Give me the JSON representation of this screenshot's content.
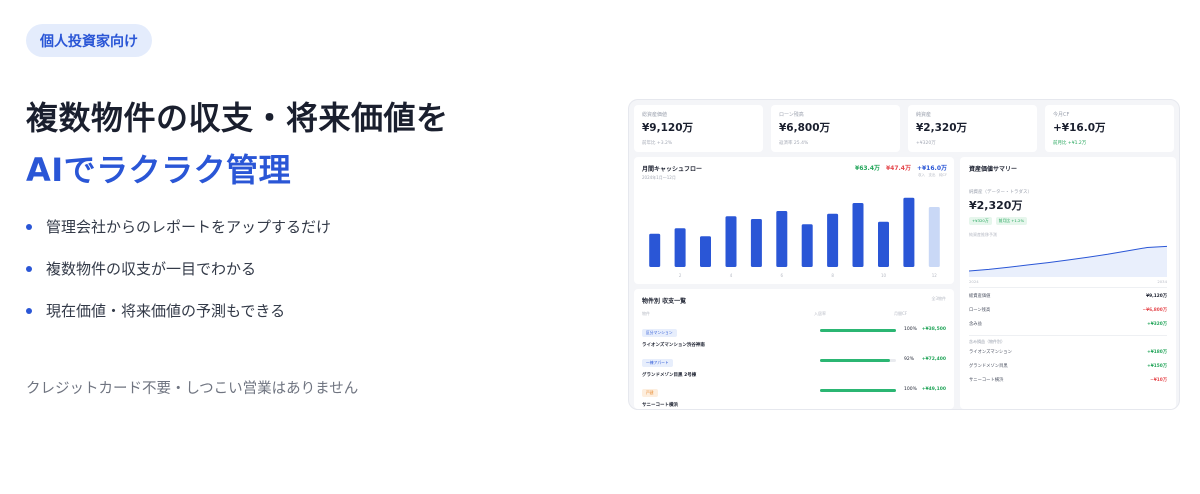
{
  "hero": {
    "badge": "個人投資家向け",
    "headline_line1": "複数物件の収支・将来価値を",
    "headline_line2": "AIでラクラク管理",
    "bullets": [
      "管理会社からのレポートをアップするだけ",
      "複数物件の収支が一目でわかる",
      "現在価値・将来価値の予測もできる"
    ],
    "note": "クレジットカード不要・しつこい営業はありません"
  },
  "colors": {
    "accent": "#2a56d6",
    "green": "#23a55a",
    "red": "#e5484d"
  },
  "dashboard": {
    "kpis": [
      {
        "label": "総資産価値",
        "value": "¥9,120万",
        "sub": "前年比 +3.2%",
        "sub_green": false
      },
      {
        "label": "ローン残高",
        "value": "¥6,800万",
        "sub": "返済率 25.4%",
        "sub_green": false
      },
      {
        "label": "純資産",
        "value": "¥2,320万",
        "sub": "+¥320万",
        "sub_green": false
      },
      {
        "label": "今月CF",
        "value": "+¥16.0万",
        "sub": "前月比 +¥1.2万",
        "sub_green": true
      }
    ],
    "cashflow": {
      "title": "月間キャッシュフロー",
      "subtitle": "2024年1月〜12月",
      "legend_income": "¥63.4万",
      "legend_expense": "¥47.4万",
      "legend_net": "+¥16.0万",
      "legend_sub": "収入　支出　純CF"
    },
    "chart_data": {
      "type": "bar",
      "categories": [
        "1",
        "2",
        "3",
        "4",
        "5",
        "6",
        "7",
        "8",
        "9",
        "10",
        "11",
        "12"
      ],
      "values": [
        12.5,
        14.5,
        11.5,
        19.0,
        18.0,
        21.0,
        16.0,
        20.0,
        24.0,
        17.0,
        26.0,
        22.5
      ],
      "highlight_last": true,
      "ylim": [
        0,
        30
      ],
      "grid": false
    },
    "property_list": {
      "title": "物件別 収支一覧",
      "top_right": "全3物件",
      "col_name": "物件",
      "col_rate": "入居率",
      "col_cf": "月間CF",
      "rows": [
        {
          "tag": "区分マンション",
          "tag_color": "blue",
          "name": "ライオンズマンション渋谷神南",
          "rate": 1.0,
          "rate_label": "100%",
          "amount": "+¥38,500"
        },
        {
          "tag": "一棟アパート",
          "tag_color": "blue",
          "name": "グランドメゾン目黒 2号棟",
          "rate": 0.92,
          "rate_label": "92%",
          "amount": "+¥72,400"
        },
        {
          "tag": "戸建",
          "tag_color": "orange",
          "name": "サニーコート横浜",
          "rate": 1.0,
          "rate_label": "100%",
          "amount": "+¥49,100"
        }
      ]
    },
    "summary": {
      "title": "資産価値サマリー",
      "sub": "純資産（データー・トラダス）",
      "value": "¥2,320万",
      "chips": [
        "+¥320万",
        "前月比 +1.2%"
      ],
      "chart_label": "純資産推移予測",
      "axis_start": "2024",
      "axis_end": "2034",
      "future_values": [
        2320,
        2400,
        2520,
        2640,
        2760,
        2900,
        3050,
        3200,
        3380,
        3560,
        3620
      ],
      "rows_top": [
        {
          "label": "総資産価値",
          "value": "¥9,120万",
          "color": "dark"
        },
        {
          "label": "ローン残高",
          "value": "−¥6,800万",
          "color": "red"
        },
        {
          "label": "含み益",
          "value": "+¥320万",
          "color": "green"
        }
      ],
      "section_head": "含み損益（物件別）",
      "rows_bottom": [
        {
          "label": "ライオンズマンション",
          "value": "+¥180万",
          "color": "green"
        },
        {
          "label": "グランドメゾン目黒",
          "value": "+¥150万",
          "color": "green"
        },
        {
          "label": "サニーコート横浜",
          "value": "−¥10万",
          "color": "red"
        }
      ]
    }
  }
}
